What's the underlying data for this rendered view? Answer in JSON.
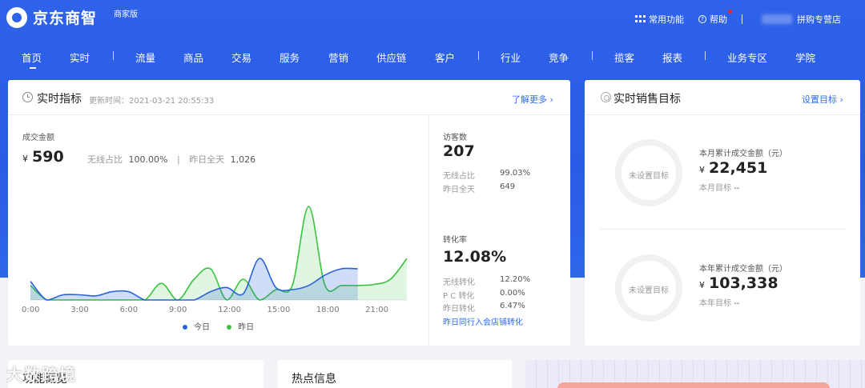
{
  "brand": {
    "name": "京东商智",
    "sub": "商家版"
  },
  "topbar": {
    "functions": "常用功能",
    "help": "帮助",
    "store": "拼购专营店"
  },
  "nav": [
    "首页",
    "实时",
    "流量",
    "商品",
    "交易",
    "服务",
    "营销",
    "供应链",
    "客户",
    "行业",
    "竞争",
    "揽客",
    "报表",
    "业务专区",
    "学院"
  ],
  "realtime": {
    "title": "实时指标",
    "updated": "更新时间：2021-03-21 20:55:33",
    "more": "了解更多",
    "gmv_label": "成交金额",
    "gmv_currency": "¥",
    "gmv_value": "590",
    "wireless_ratio_label": "无线占比",
    "wireless_ratio": "100.00%",
    "yesterday_label": "昨日全天",
    "yesterday_value": "1,026",
    "visitors_label": "访客数",
    "visitors_value": "207",
    "visitors_wireless_label": "无线占比",
    "visitors_wireless_value": "99.03%",
    "visitors_yesterday_label": "昨日全天",
    "visitors_yesterday_value": "649",
    "conv_label": "转化率",
    "conv_value": "12.08%",
    "conv_wireless_label": "无线转化",
    "conv_wireless_value": "12.20%",
    "conv_pc_label": "P C 转化",
    "conv_pc_value": "0.00%",
    "conv_yesterday_label": "昨日转化",
    "conv_yesterday_value": "6.47%",
    "peer_link": "昨日同行入会店铺转化"
  },
  "chart_data": {
    "type": "area",
    "x_ticks": [
      "0:00",
      "3:00",
      "6:00",
      "9:00",
      "12:00",
      "15:00",
      "18:00",
      "21:00"
    ],
    "x_hours": [
      0,
      1,
      2,
      3,
      4,
      5,
      6,
      7,
      8,
      9,
      10,
      11,
      12,
      13,
      14,
      15,
      16,
      17,
      18,
      19,
      20,
      21,
      22,
      23
    ],
    "series": [
      {
        "name": "今日",
        "color": "#2a62d8",
        "values": [
          18,
          0,
          5,
          5,
          4,
          8,
          8,
          0,
          0,
          0,
          0,
          8,
          12,
          6,
          40,
          12,
          10,
          14,
          24,
          30,
          30,
          null,
          null,
          null
        ]
      },
      {
        "name": "昨日",
        "color": "#38c43c",
        "values": [
          14,
          0,
          0,
          0,
          0,
          0,
          0,
          0,
          16,
          0,
          20,
          30,
          0,
          20,
          0,
          10,
          14,
          90,
          14,
          14,
          14,
          15,
          20,
          40
        ]
      }
    ],
    "ylim": [
      0,
      100
    ],
    "legend": "bottom-center"
  },
  "target": {
    "title": "实时销售目标",
    "set_link": "设置目标",
    "unset": "未设置目标",
    "month_label": "本月累计成交金额（元）",
    "month_currency": "¥",
    "month_value": "22,451",
    "month_target_label": "本月目标",
    "month_target_value": "--",
    "year_label": "本年累计成交金额（元）",
    "year_currency": "¥",
    "year_value": "103,338",
    "year_target_label": "本年目标",
    "year_target_value": "--"
  },
  "bottom": {
    "overview": "功能概览",
    "hot": "热点信息"
  },
  "watermark": "大数跨境",
  "colors": {
    "primary": "#2f62e9",
    "link": "#2e6cf0",
    "today": "#2a62d8",
    "yesterday": "#38c43c"
  }
}
